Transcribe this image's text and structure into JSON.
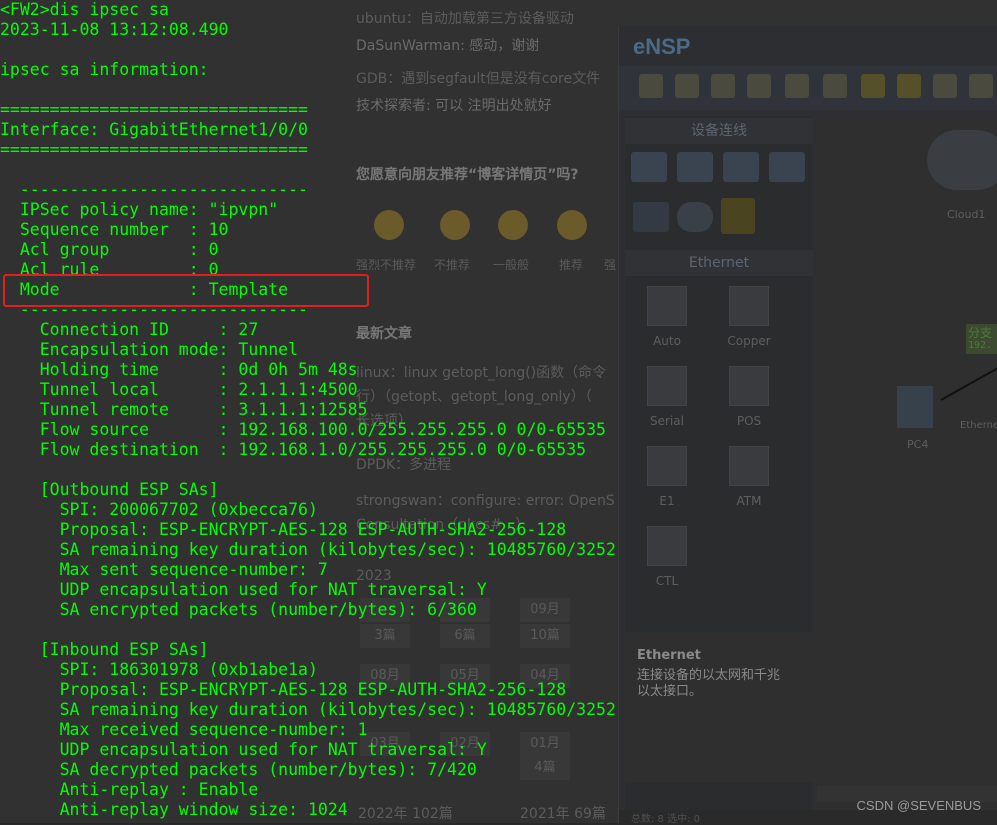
{
  "terminal": {
    "lines": [
      "<FW2>dis ipsec sa",
      "2023-11-08 13:12:08.490",
      "",
      "ipsec sa information:",
      "",
      "===============================",
      "Interface: GigabitEthernet1/0/0",
      "===============================",
      "",
      "  -----------------------------",
      "  IPSec policy name: \"ipvpn\"",
      "  Sequence number  : 10",
      "  Acl group        : 0",
      "  Acl rule         : 0",
      "  Mode             : Template",
      "  -----------------------------",
      "    Connection ID     : 27",
      "    Encapsulation mode: Tunnel",
      "    Holding time      : 0d 0h 5m 48s",
      "    Tunnel local      : 2.1.1.1:4500",
      "    Tunnel remote     : 3.1.1.1:12585",
      "    Flow source       : 192.168.100.0/255.255.255.0 0/0-65535",
      "    Flow destination  : 192.168.1.0/255.255.255.0 0/0-65535",
      "",
      "    [Outbound ESP SAs]",
      "      SPI: 200067702 (0xbecca76)",
      "      Proposal: ESP-ENCRYPT-AES-128 ESP-AUTH-SHA2-256-128",
      "      SA remaining key duration (kilobytes/sec): 10485760/3252",
      "      Max sent sequence-number: 7",
      "      UDP encapsulation used for NAT traversal: Y",
      "      SA encrypted packets (number/bytes): 6/360",
      "",
      "    [Inbound ESP SAs]",
      "      SPI: 186301978 (0xb1abe1a)",
      "      Proposal: ESP-ENCRYPT-AES-128 ESP-AUTH-SHA2-256-128",
      "      SA remaining key duration (kilobytes/sec): 10485760/3252",
      "      Max received sequence-number: 1",
      "      UDP encapsulation used for NAT traversal: Y",
      "      SA decrypted packets (number/bytes): 7/420",
      "      Anti-replay : Enable",
      "      Anti-replay window size: 1024"
    ]
  },
  "blog": {
    "comment1": "ubuntu：自动加载第三方设备驱动",
    "comment2": "DaSunWarman: 感动，谢谢",
    "comment3": "GDB：遇到segfault但是没有core文件",
    "comment4": "技术探索者: 可以 注明出处就好",
    "recommend": "您愿意向朋友推荐“博客详情页”吗?",
    "ratings": [
      "强烈不推荐",
      "不推荐",
      "一般般",
      "推荐",
      "强"
    ],
    "latest_title": "最新文章",
    "article1": "linux：linux getopt_long()函数（命令",
    "article1b": "行）（getopt、getopt_long_only）（",
    "article1c": "长选项）",
    "article2": "DPDK：多进程",
    "article3": "strongswan：configure: error: OpenS",
    "article3b": "Consultation（pkcs#...）",
    "year": "2023",
    "cal_months": [
      "09月",
      "08月",
      "05月",
      "04月",
      "03月",
      "02月",
      "01月"
    ],
    "cal_counts": [
      "3篇",
      "6篇",
      "10篇",
      "4篇"
    ],
    "footer1": "2022年 102篇",
    "footer2": "2021年 69篇"
  },
  "ensp": {
    "title": "eNSP",
    "panel_title": "设备连线",
    "ethernet_head": "Ethernet",
    "cables": [
      "Auto",
      "Copper",
      "Serial",
      "POS",
      "E1",
      "ATM",
      "CTL"
    ],
    "info_title": "Ethernet",
    "info_desc": "连接设备的以太网和千兆以太接口。",
    "cloud_label": "Cloud1",
    "pc_label": "PC4",
    "branch_label": "分支",
    "branch_ip": "192.",
    "link_label": "Etherne",
    "status_text": "总数: 8 选中: 0"
  },
  "watermark": "CSDN @SEVENBUS"
}
